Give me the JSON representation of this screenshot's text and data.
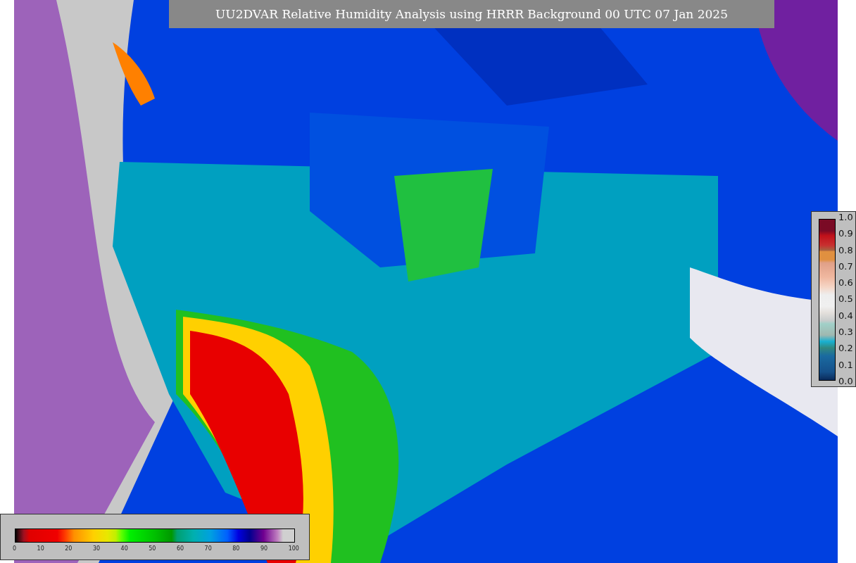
{
  "title": "UU2DVAR Relative Humidity Analysis using HRRR Background 00 UTC 07 Jan 2025",
  "humidity_legend": {
    "ticks": [
      "0",
      "10",
      "20",
      "30",
      "40",
      "50",
      "60",
      "70",
      "80",
      "90",
      "100"
    ]
  },
  "observation_legend": {
    "ticks": [
      "1.0",
      "0.9",
      "0.8",
      "0.7",
      "0.6",
      "0.5",
      "0.4",
      "0.3",
      "0.2",
      "0.1",
      "0.0"
    ]
  }
}
